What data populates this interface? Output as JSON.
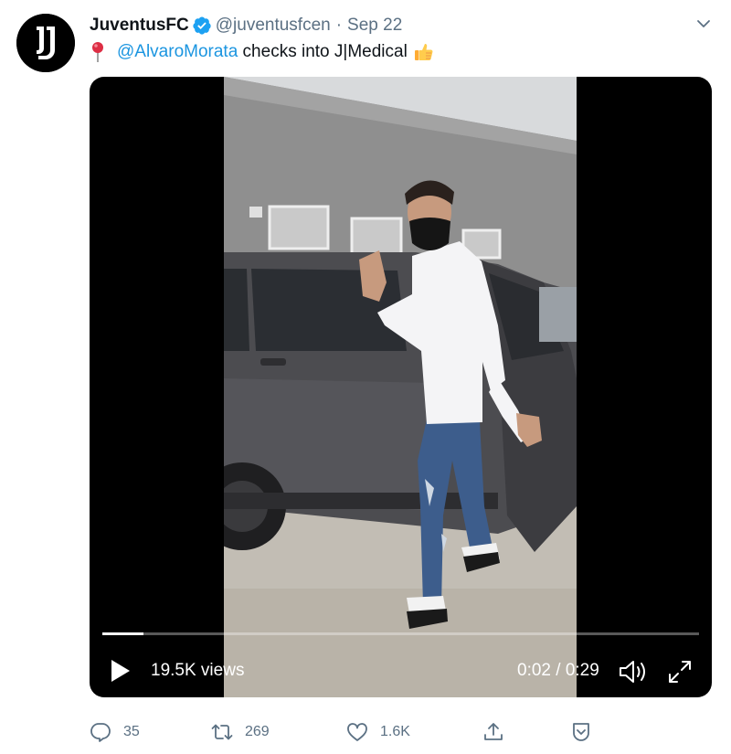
{
  "tweet": {
    "author_name": "JuventusFC",
    "handle": "@juventusfcen",
    "separator": "·",
    "date": "Sep 22",
    "text_mention": "@AlvaroMorata",
    "text_body": " checks into J|Medical",
    "emoji_pin": "round-pushpin-icon",
    "emoji_thumbs": "thumbs-up-icon"
  },
  "video": {
    "views": "19.5K views",
    "time": "0:02 / 0:29",
    "progress": 0.0689
  },
  "actions": {
    "reply_count": "35",
    "retweet_count": "269",
    "like_count": "1.6K"
  },
  "colors": {
    "link": "#1b95e0",
    "secondary_text": "#5b7083",
    "verified": "#1da1f2"
  }
}
